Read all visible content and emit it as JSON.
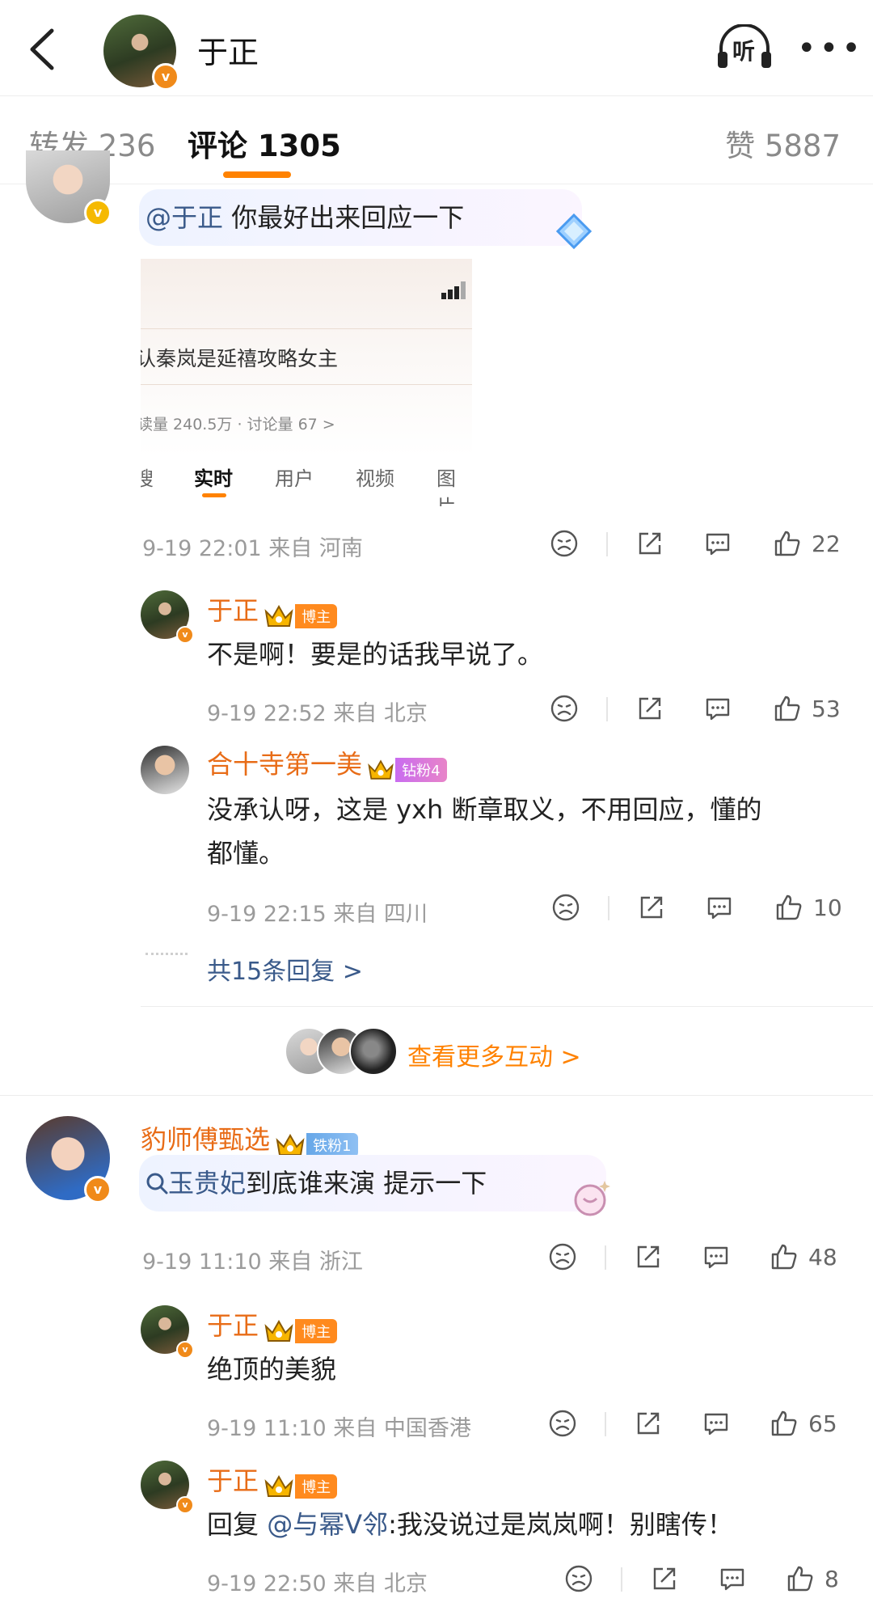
{
  "header": {
    "title": "于正",
    "listen_label": "听"
  },
  "tabs": {
    "repost": "转发 236",
    "comment": "评论 1305",
    "like": "赞 5887"
  },
  "comment1": {
    "mention": "@于正",
    "text": " 你最好出来回应一下",
    "screenshot": {
      "line1": "认秦岚是延禧攻略女主",
      "stats": "读量 240.5万 · 讨论量 67 >",
      "tabs": [
        "搜",
        "实时",
        "用户",
        "视频",
        "图片"
      ]
    },
    "meta": "9-19 22:01 来自 河南",
    "likes": "22",
    "replies": [
      {
        "name": "于正",
        "tag": "博主",
        "text": "不是啊！要是的话我早说了。",
        "meta": "9-19 22:52 来自 北京",
        "likes": "53"
      },
      {
        "name": "合十寺第一美",
        "tag": "钻粉4",
        "text1": "没承认呀，这是 yxh 断章取义，不用回应，懂的",
        "text2": "都懂。",
        "meta": "9-19 22:15 来自 四川",
        "likes": "10"
      }
    ],
    "more_replies": "共15条回复 >",
    "more_interactions": "查看更多互动 >"
  },
  "comment2": {
    "name": "豹师傅甄选",
    "tag": "铁粉1",
    "search_link": "玉贵妃",
    "text": "到底谁来演 提示一下",
    "meta": "9-19 11:10 来自 浙江",
    "likes": "48",
    "replies": [
      {
        "name": "于正",
        "tag": "博主",
        "text": "绝顶的美貌",
        "meta": "9-19 11:10 来自 中国香港",
        "likes": "65"
      },
      {
        "name": "于正",
        "tag": "博主",
        "reply_prefix": "回复",
        "reply_mention": "@与幂V邻",
        "text": ":我没说过是岚岚啊！别瞎传！",
        "meta": "9-19 22:50 来自 北京",
        "likes": "8"
      }
    ]
  },
  "colors": {
    "accent": "#ff8200",
    "name": "#e86c17",
    "link": "#3a5a8a"
  }
}
